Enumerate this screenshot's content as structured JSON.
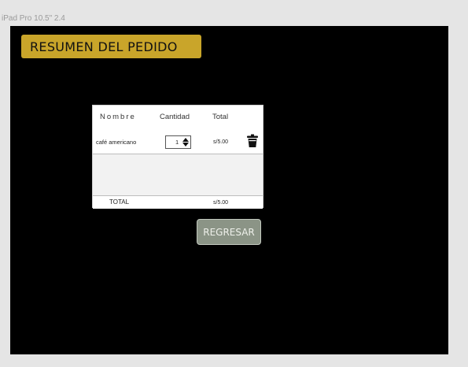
{
  "frame": {
    "label": "iPad Pro 10.5\" 2.4"
  },
  "header": {
    "title": "RESUMEN DEL PEDIDO"
  },
  "table": {
    "columns": {
      "nombre": "Nombre",
      "cantidad": "Cantidad",
      "total": "Total"
    },
    "rows": [
      {
        "nombre": "café americano",
        "cantidad": "1",
        "total": "s/5.00"
      }
    ],
    "footer": {
      "label": "TOTAL",
      "total": "s/5.00"
    }
  },
  "actions": {
    "back_label": "REGRESAR"
  },
  "icons": {
    "delete": "trash-icon",
    "stepper": "up-down-arrows-icon"
  },
  "colors": {
    "banner": "#c9a52a",
    "canvas": "#000000",
    "back_button": "#8b9486"
  }
}
